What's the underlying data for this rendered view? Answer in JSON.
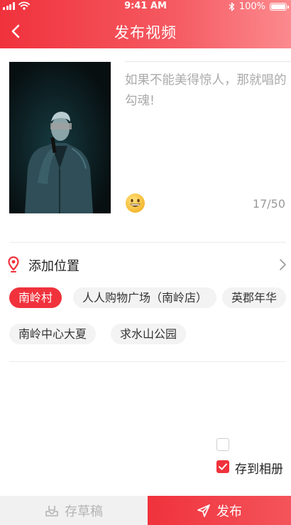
{
  "status_bar": {
    "time": "9:41 AM",
    "battery": "100%"
  },
  "nav": {
    "title": "发布视频"
  },
  "compose": {
    "caption_placeholder": "如果不能美得惊人，那就唱的勾魂!",
    "counter": "17/50"
  },
  "location": {
    "label": "添加位置",
    "chips": [
      {
        "label": "南岭村",
        "selected": true
      },
      {
        "label": "人人购物广场（南岭店）",
        "selected": false
      },
      {
        "label": "英郡年华",
        "selected": false
      },
      {
        "label": "南岭中心大夏",
        "selected": false
      },
      {
        "label": "求水山公园",
        "selected": false
      }
    ]
  },
  "options": {
    "unlabeled_checkbox_checked": false,
    "save_album": {
      "label": "存到相册",
      "checked": true
    }
  },
  "bottom_bar": {
    "draft_label": "存草稿",
    "publish_label": "发布"
  },
  "colors": {
    "accent": "#f0323c",
    "accent_light": "#fb8a8e",
    "placeholder": "#aaaaaa",
    "chip_bg": "#f3f3f3"
  }
}
